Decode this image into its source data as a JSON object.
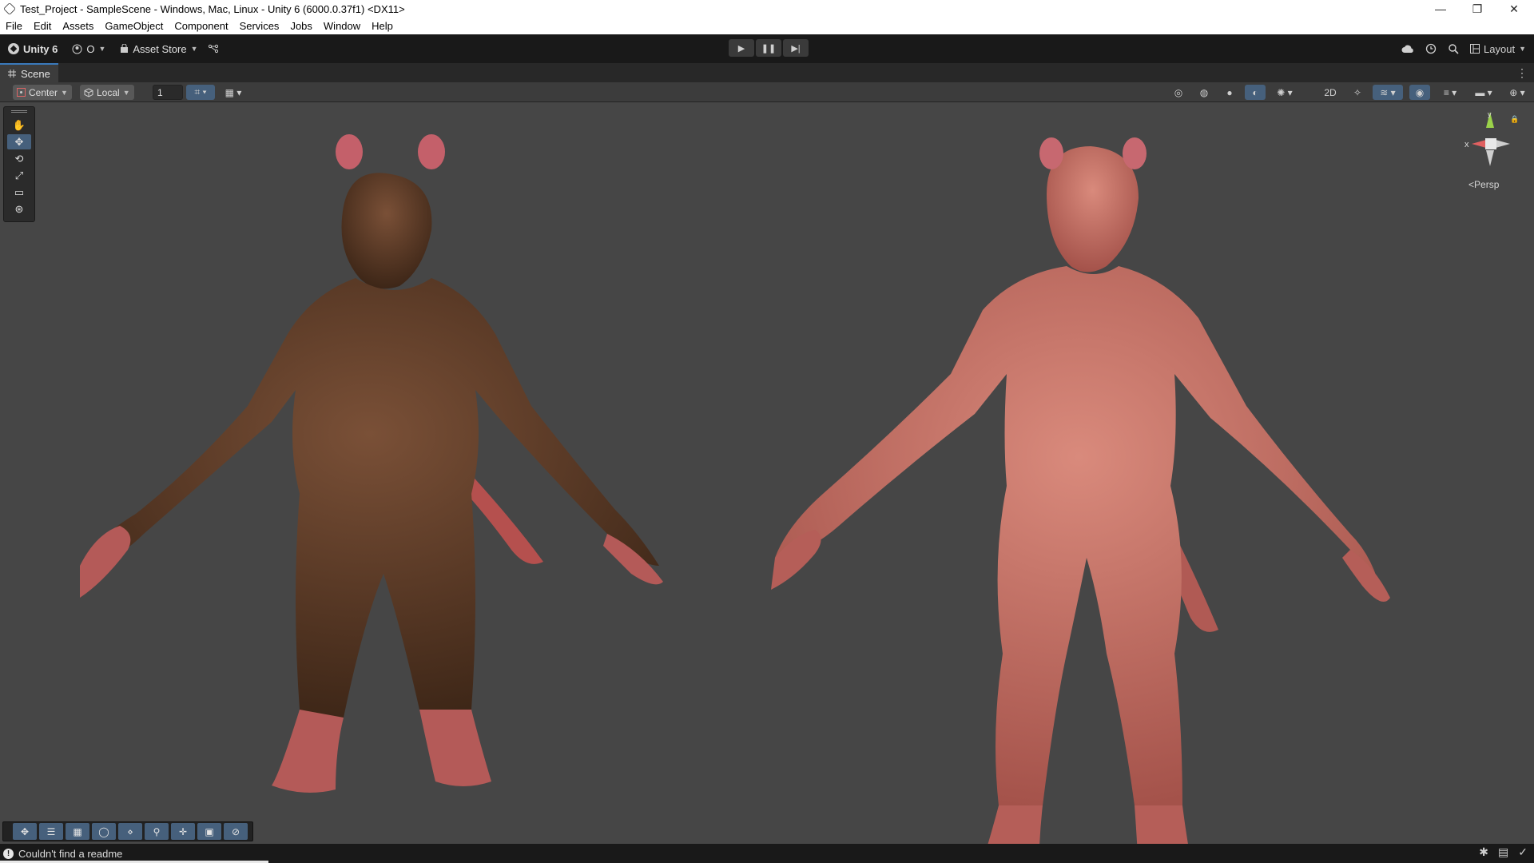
{
  "window": {
    "title": "Test_Project - SampleScene - Windows, Mac, Linux - Unity 6 (6000.0.37f1) <DX11>",
    "controls": {
      "minimize": "—",
      "restore": "❐",
      "close": "✕"
    }
  },
  "menu": [
    "File",
    "Edit",
    "Assets",
    "GameObject",
    "Component",
    "Services",
    "Jobs",
    "Window",
    "Help"
  ],
  "toolbar": {
    "account_label": "Unity 6",
    "collab_label": "O",
    "asset_store_label": "Asset Store",
    "play_icons": [
      "play-icon",
      "pause-icon",
      "step-icon"
    ],
    "layout_label": "Layout"
  },
  "scene_tab": {
    "label": "Scene"
  },
  "scene_toolbar": {
    "pivot_label": "Center",
    "space_label": "Local",
    "grid_increment_value": "1"
  },
  "viewport": {
    "gizmo_axes": {
      "x": "x",
      "y": "y"
    },
    "projection_label": "Persp",
    "models": [
      "furred rat creature",
      "skinned rat creature"
    ]
  },
  "colors": {
    "accent_blue": "#46607c",
    "tab_highlight": "#3a79bb",
    "viewport_bg": "#464646",
    "fur": "#5b3a26",
    "skin": "#c2665a"
  },
  "status": {
    "message": "Couldn't find a readme"
  }
}
